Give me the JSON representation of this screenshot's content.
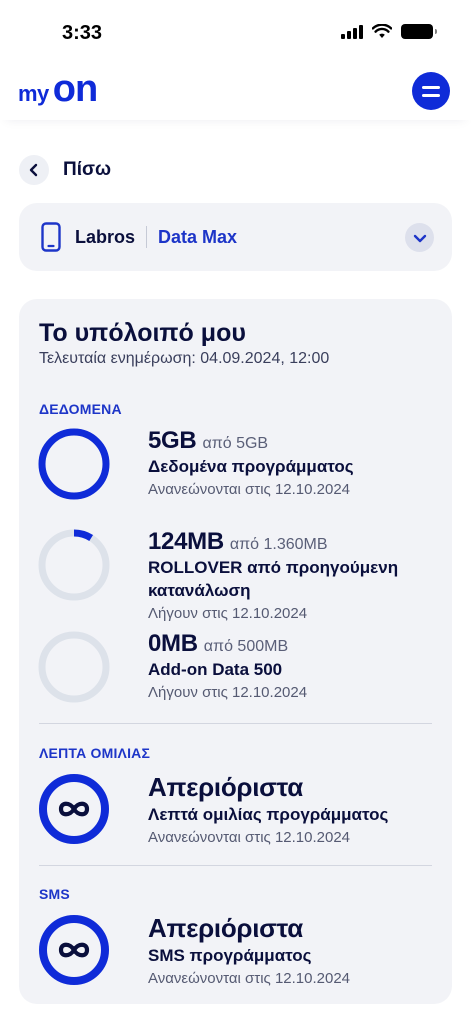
{
  "status_bar": {
    "time": "3:33"
  },
  "header": {
    "logo_my": "my",
    "logo_on": "on",
    "menu_icon": "hamburger-menu-icon"
  },
  "nav": {
    "back_label": "Πίσω"
  },
  "line": {
    "name": "Labros",
    "plan": "Data Max"
  },
  "balance": {
    "title": "Το υπόλοιπό μου",
    "updated": "Τελευταία ενημέρωση: 04.09.2024, 12:00",
    "sections": {
      "data": {
        "label": "ΔΕΔΟΜΕΝΑ",
        "items": [
          {
            "amount": "5GB",
            "of": "από 5GB",
            "name": "Δεδομένα προγράμματος",
            "note": "Ανανεώνονται στις 12.10.2024",
            "progress": 1.0
          },
          {
            "amount": "124MB",
            "of": "από 1.360MB",
            "name": "ROLLOVER από προηγούμενη κατανάλωση",
            "note": "Λήγουν στις 12.10.2024",
            "progress": 0.09
          },
          {
            "amount": "0MB",
            "of": "από 500MB",
            "name": "Add-on Data 500",
            "note": "Λήγουν στις 12.10.2024",
            "progress": 0.0
          }
        ]
      },
      "voice": {
        "label": "ΛΕΠΤΑ ΟΜΙΛΙΑΣ",
        "value": "Απεριόριστα",
        "name": "Λεπτά ομιλίας προγράμματος",
        "note": "Ανανεώνονται στις 12.10.2024"
      },
      "sms": {
        "label": "SMS",
        "value": "Απεριόριστα",
        "name": "SMS προγράμματος",
        "note": "Ανανεώνονται στις 12.10.2024"
      }
    }
  },
  "colors": {
    "brand": "#0f2bd8",
    "ring_track": "#dde2ea",
    "card_bg": "#f2f3f7"
  }
}
